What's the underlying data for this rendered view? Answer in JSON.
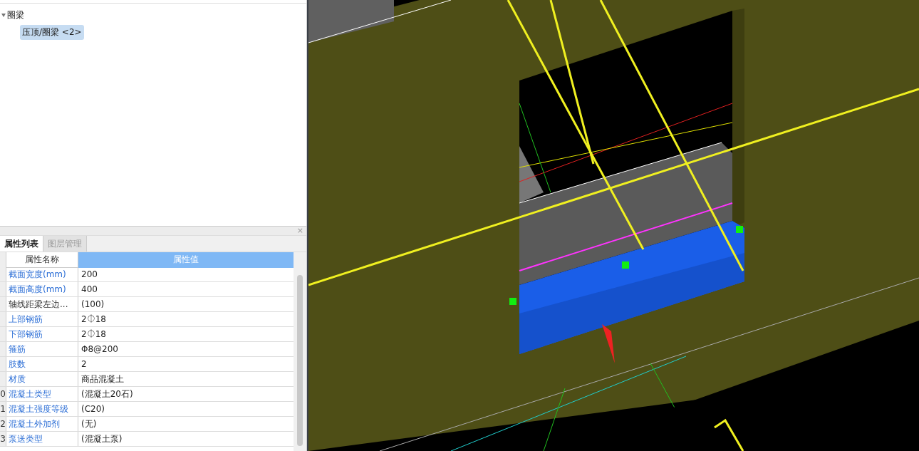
{
  "tree": {
    "label": "圈梁",
    "expanded": true,
    "children": [
      {
        "label": "压顶/圈梁 <2>",
        "selected": true
      }
    ]
  },
  "panel": {
    "close": "×",
    "tabs": [
      {
        "label": "属性列表",
        "selected": true
      },
      {
        "label": "图层管理",
        "selected": false
      }
    ],
    "columns": [
      "属性名称",
      "属性值"
    ],
    "rows": [
      {
        "name": "截面宽度(mm)",
        "value": "200",
        "public": true
      },
      {
        "name": "截面高度(mm)",
        "value": "400",
        "public": true
      },
      {
        "name": "轴线距梁左边...",
        "value": "(100)",
        "public": false
      },
      {
        "name": "上部钢筋",
        "value": "2⏀18",
        "public": true
      },
      {
        "name": "下部钢筋",
        "value": "2⏀18",
        "public": true
      },
      {
        "name": "箍筋",
        "value": "Φ8@200",
        "public": true
      },
      {
        "name": "肢数",
        "value": "2",
        "public": true
      },
      {
        "name": "材质",
        "value": "商品混凝土",
        "public": true
      },
      {
        "index": "0",
        "name": "混凝土类型",
        "value": "(混凝土20石)",
        "public": true
      },
      {
        "index": "1",
        "name": "混凝土强度等级",
        "value": "(C20)",
        "public": true
      },
      {
        "index": "2",
        "name": "混凝土外加剂",
        "value": "(无)",
        "public": true
      },
      {
        "index": "3",
        "name": "泵送类型",
        "value": "(混凝土泵)",
        "public": true
      }
    ]
  }
}
